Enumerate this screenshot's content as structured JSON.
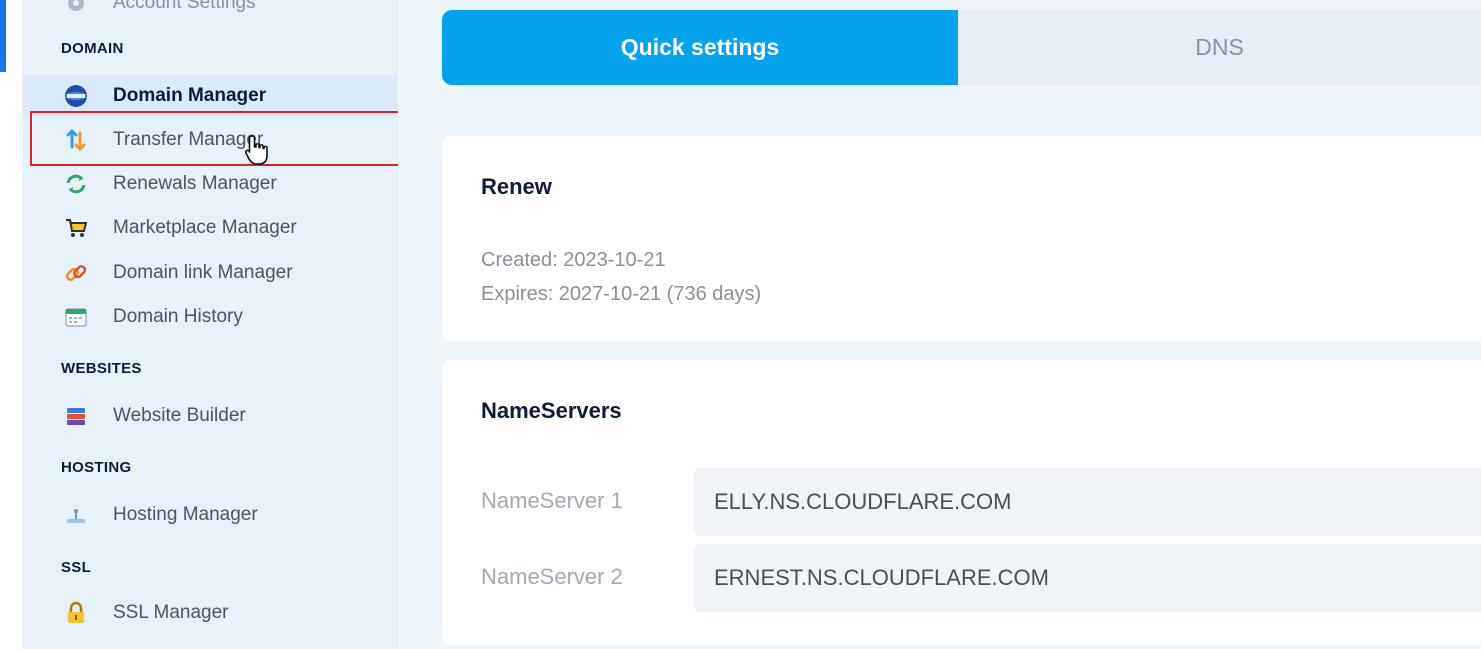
{
  "sidebar": {
    "cut_item_label": "Account Settings",
    "sections": {
      "domain": "DOMAIN",
      "websites": "WEBSITES",
      "hosting": "HOSTING",
      "ssl": "SSL"
    },
    "items": {
      "domain_manager": "Domain Manager",
      "transfer_manager": "Transfer Manager",
      "renewals_manager": "Renewals Manager",
      "marketplace_manager": "Marketplace Manager",
      "domain_link_manager": "Domain link Manager",
      "domain_history": "Domain History",
      "website_builder": "Website Builder",
      "hosting_manager": "Hosting Manager",
      "ssl_manager": "SSL Manager"
    },
    "active_item": "Domain Manager",
    "highlighted_item": "Transfer Manager"
  },
  "tabs": {
    "quick_settings": "Quick settings",
    "dns": "DNS",
    "active": "Quick settings"
  },
  "renew_card": {
    "title": "Renew",
    "created": "Created: 2023-10-21",
    "expires": "Expires: 2027-10-21 (736 days)"
  },
  "nameservers_card": {
    "title": "NameServers",
    "rows": [
      {
        "label": "NameServer 1",
        "value": "ELLY.NS.CLOUDFLARE.COM"
      },
      {
        "label": "NameServer 2",
        "value": "ERNEST.NS.CLOUDFLARE.COM"
      }
    ]
  },
  "colors": {
    "accent_tab": "#05a3ec",
    "highlight_box": "#e0202a",
    "edge_indicator": "#1577e6"
  }
}
